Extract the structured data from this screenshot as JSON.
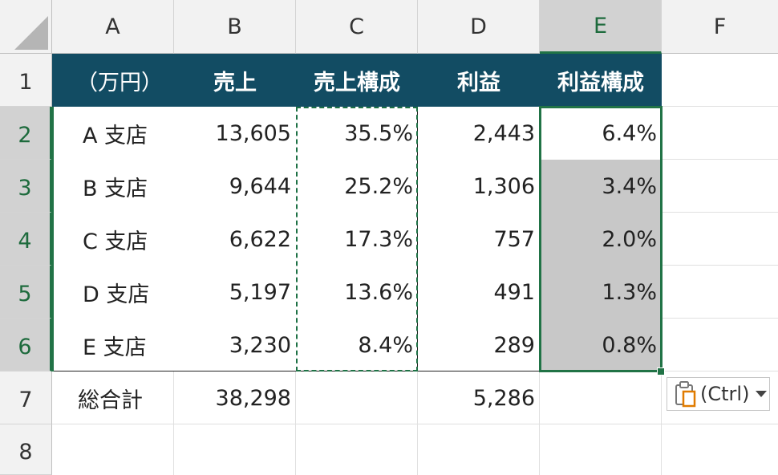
{
  "columns": [
    "A",
    "B",
    "C",
    "D",
    "E",
    "F"
  ],
  "rows": [
    "1",
    "2",
    "3",
    "4",
    "5",
    "6",
    "7",
    "8"
  ],
  "selected_column": "E",
  "selected_rows": [
    "2",
    "3",
    "4",
    "5",
    "6"
  ],
  "table": {
    "headers": [
      "（万円）",
      "売上",
      "売上構成",
      "利益",
      "利益構成"
    ],
    "branches": [
      {
        "name": "A 支店",
        "sales": "13,605",
        "sales_ratio": "35.5%",
        "profit": "2,443",
        "profit_ratio": "6.4%"
      },
      {
        "name": "B 支店",
        "sales": "9,644",
        "sales_ratio": "25.2%",
        "profit": "1,306",
        "profit_ratio": "3.4%"
      },
      {
        "name": "C 支店",
        "sales": "6,622",
        "sales_ratio": "17.3%",
        "profit": "757",
        "profit_ratio": "2.0%"
      },
      {
        "name": "D 支店",
        "sales": "5,197",
        "sales_ratio": "13.6%",
        "profit": "491",
        "profit_ratio": "1.3%"
      },
      {
        "name": "E 支店",
        "sales": "3,230",
        "sales_ratio": "8.4%",
        "profit": "289",
        "profit_ratio": "0.8%"
      }
    ],
    "total": {
      "label": "総合計",
      "sales": "38,298",
      "profit": "5,286"
    }
  },
  "paste_options": {
    "label": "(Ctrl)",
    "icon": "clipboard-icon"
  },
  "colors": {
    "header_fill": "#124c63",
    "header_text": "#ffffff",
    "selection": "#217346",
    "shaded_cells": "#c8c8c8",
    "paste_icon_accent": "#e07b00"
  }
}
